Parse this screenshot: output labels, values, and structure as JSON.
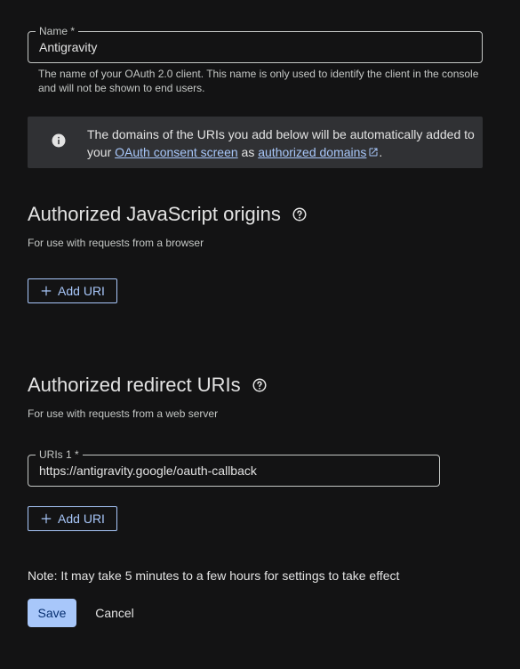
{
  "name_field": {
    "label": "Name *",
    "value": "Antigravity",
    "hint": "The name of your OAuth 2.0 client. This name is only used to identify the client in the console and will not be shown to end users."
  },
  "info_banner": {
    "text_prefix": "The domains of the URIs you add below will be automatically added to your ",
    "link1": "OAuth consent screen",
    "text_middle": " as ",
    "link2": "authorized domains",
    "text_suffix": "."
  },
  "js_origins": {
    "title": "Authorized JavaScript origins",
    "subtitle": "For use with requests from a browser",
    "add_button": "Add URI"
  },
  "redirect_uris": {
    "title": "Authorized redirect URIs",
    "subtitle": "For use with requests from a web server",
    "uri_label": "URIs 1 *",
    "uri_value": "https://antigravity.google/oauth-callback",
    "add_button": "Add URI"
  },
  "note": "Note: It may take 5 minutes to a few hours for settings to take effect",
  "actions": {
    "save": "Save",
    "cancel": "Cancel"
  },
  "colors": {
    "background": "#131314",
    "accent": "#a8c7fa",
    "banner": "#303134"
  }
}
